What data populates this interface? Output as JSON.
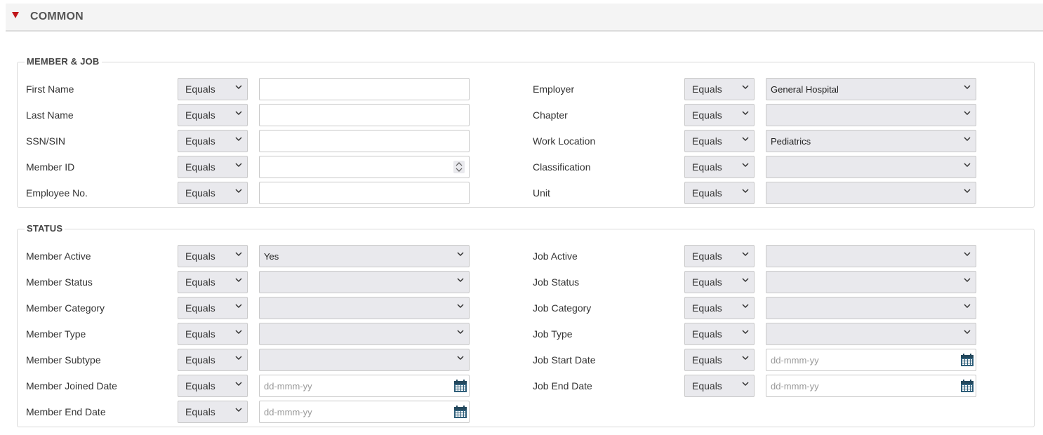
{
  "section": {
    "title": "COMMON"
  },
  "member_job": {
    "legend": "MEMBER & JOB",
    "left_rows": [
      {
        "label": "First Name",
        "operator": "Equals",
        "value": "",
        "kind": "text"
      },
      {
        "label": "Last Name",
        "operator": "Equals",
        "value": "",
        "kind": "text"
      },
      {
        "label": "SSN/SIN",
        "operator": "Equals",
        "value": "",
        "kind": "text"
      },
      {
        "label": "Member ID",
        "operator": "Equals",
        "value": "",
        "kind": "number"
      },
      {
        "label": "Employee No.",
        "operator": "Equals",
        "value": "",
        "kind": "text"
      }
    ],
    "right_rows": [
      {
        "label": "Employer",
        "operator": "Equals",
        "value": "General Hospital",
        "kind": "select"
      },
      {
        "label": "Chapter",
        "operator": "Equals",
        "value": "",
        "kind": "select"
      },
      {
        "label": "Work Location",
        "operator": "Equals",
        "value": "Pediatrics",
        "kind": "select"
      },
      {
        "label": "Classification",
        "operator": "Equals",
        "value": "",
        "kind": "select"
      },
      {
        "label": "Unit",
        "operator": "Equals",
        "value": "",
        "kind": "select"
      }
    ]
  },
  "status": {
    "legend": "STATUS",
    "left_rows": [
      {
        "label": "Member Active",
        "operator": "Equals",
        "value": "Yes",
        "kind": "select"
      },
      {
        "label": "Member Status",
        "operator": "Equals",
        "value": "",
        "kind": "select"
      },
      {
        "label": "Member Category",
        "operator": "Equals",
        "value": "",
        "kind": "select"
      },
      {
        "label": "Member Type",
        "operator": "Equals",
        "value": "",
        "kind": "select"
      },
      {
        "label": "Member Subtype",
        "operator": "Equals",
        "value": "",
        "kind": "select"
      },
      {
        "label": "Member Joined Date",
        "operator": "Equals",
        "placeholder": "dd-mmm-yy",
        "kind": "date"
      },
      {
        "label": "Member End Date",
        "operator": "Equals",
        "placeholder": "dd-mmm-yy",
        "kind": "date"
      }
    ],
    "right_rows": [
      {
        "label": "Job Active",
        "operator": "Equals",
        "value": "",
        "kind": "select"
      },
      {
        "label": "Job Status",
        "operator": "Equals",
        "value": "",
        "kind": "select"
      },
      {
        "label": "Job Category",
        "operator": "Equals",
        "value": "",
        "kind": "select"
      },
      {
        "label": "Job Type",
        "operator": "Equals",
        "value": "",
        "kind": "select"
      },
      {
        "label": "Job Start Date",
        "operator": "Equals",
        "placeholder": "dd-mmm-yy",
        "kind": "date"
      },
      {
        "label": "Job End Date",
        "operator": "Equals",
        "placeholder": "dd-mmm-yy",
        "kind": "date"
      }
    ]
  },
  "icons": {
    "collapse": "triangle-down-icon",
    "dropdown": "chevron-down-icon",
    "calendar": "calendar-icon",
    "spinner": "number-spinner-icon"
  },
  "colors": {
    "accent_red": "#c0161a",
    "select_bg": "#e9e9ed",
    "calendar_blue": "#2f5f7a"
  }
}
